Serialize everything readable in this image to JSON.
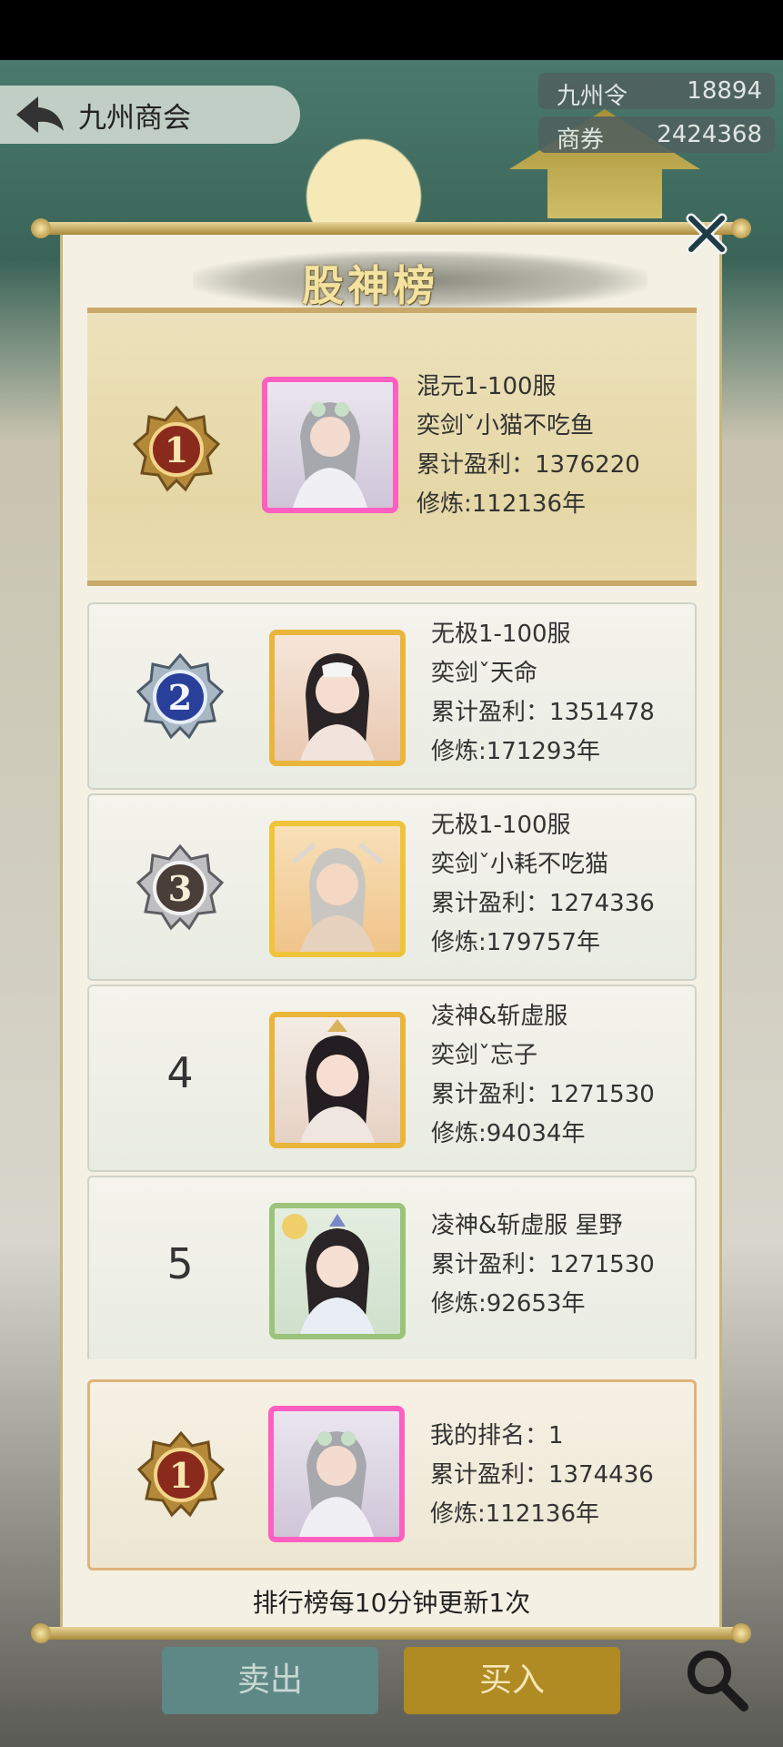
{
  "header": {
    "title": "九州商会",
    "back_icon": "back-arrow-icon"
  },
  "currencies": [
    {
      "name": "九州令",
      "value": "18894"
    },
    {
      "name": "商券",
      "value": "2424368"
    }
  ],
  "board": {
    "title": "股神榜",
    "close_icon": "close-icon"
  },
  "ranks": [
    {
      "rank": "1",
      "server": "混元1-100服",
      "name": "奕剑ˇ小猫不吃鱼",
      "profit": "累计盈利：1376220",
      "cultivation": "修炼:112136年",
      "frame_color": "#ff5fc0",
      "medal": "gold"
    },
    {
      "rank": "2",
      "server": "无极1-100服",
      "name": "奕剑ˇ天命",
      "profit": "累计盈利：1351478",
      "cultivation": "修炼:171293年",
      "frame_color": "#e9b53a",
      "medal": "blue"
    },
    {
      "rank": "3",
      "server": "无极1-100服",
      "name": "奕剑ˇ小耗不吃猫",
      "profit": "累计盈利：1274336",
      "cultivation": "修炼:179757年",
      "frame_color": "#f0c43a",
      "medal": "silver"
    },
    {
      "rank": "4",
      "server": "凌神&斩虚服",
      "name": "奕剑ˇ忘子",
      "profit": "累计盈利：1271530",
      "cultivation": "修炼:94034年",
      "frame_color": "#e9b53a"
    },
    {
      "rank": "5",
      "server": "凌神&斩虚服 星野",
      "profit": "累计盈利：1271530",
      "cultivation": "修炼:92653年",
      "frame_color": "#9cc37a"
    }
  ],
  "mine": {
    "rank": "1",
    "label": "我的排名：1",
    "profit": "累计盈利：1374436",
    "cultivation": "修炼:112136年",
    "frame_color": "#ff5fc0"
  },
  "footer_note": "排行榜每10分钟更新1次",
  "buttons": {
    "sell": "卖出",
    "buy": "买入",
    "search_icon": "search-icon"
  }
}
